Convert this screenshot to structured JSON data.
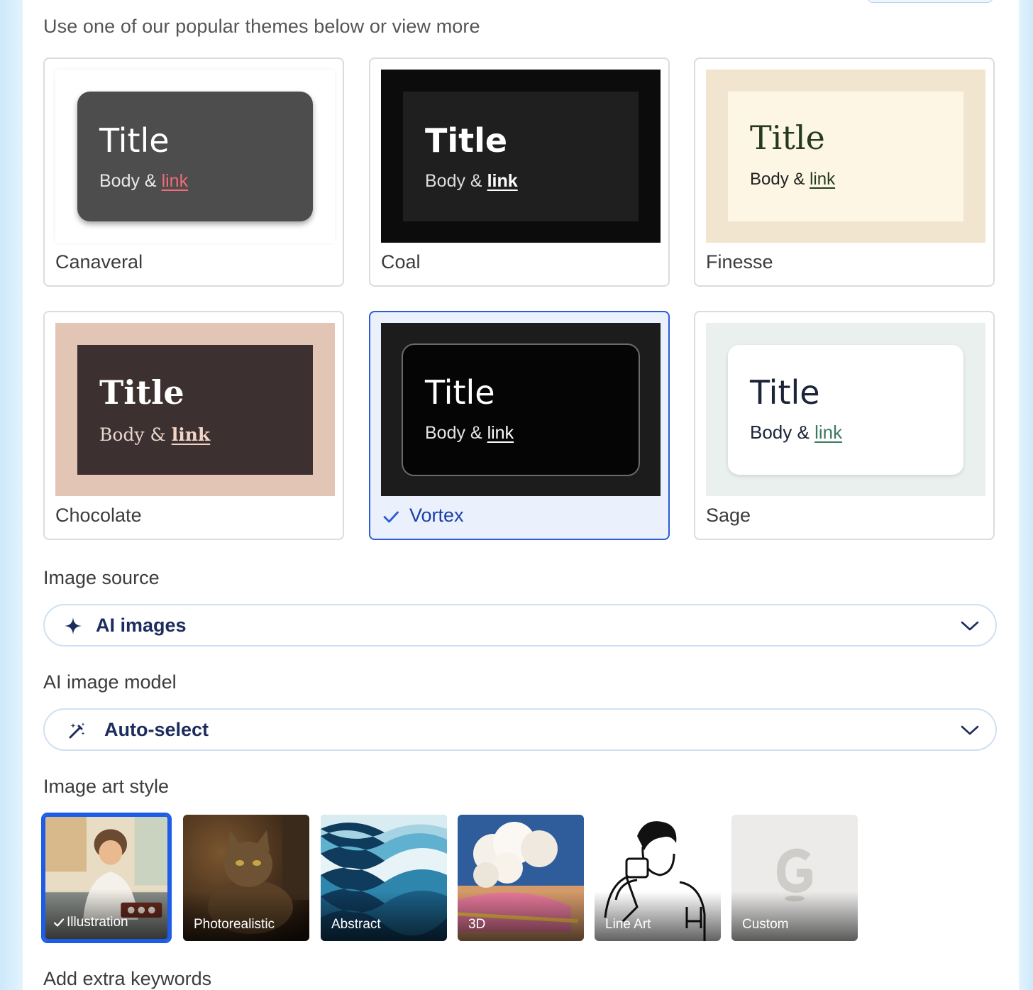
{
  "intro": "Use one of our popular themes below or view more",
  "themes": [
    {
      "name": "Canaveral",
      "title": "Title",
      "body": "Body &",
      "link": "link",
      "selected": false
    },
    {
      "name": "Coal",
      "title": "Title",
      "body": "Body &",
      "link": "link",
      "selected": false
    },
    {
      "name": "Finesse",
      "title": "Title",
      "body": "Body &",
      "link": "link",
      "selected": false
    },
    {
      "name": "Chocolate",
      "title": "Title",
      "body": "Body &",
      "link": "link",
      "selected": false
    },
    {
      "name": "Vortex",
      "title": "Title",
      "body": "Body &",
      "link": "link",
      "selected": true
    },
    {
      "name": "Sage",
      "title": "Title",
      "body": "Body &",
      "link": "link",
      "selected": false
    }
  ],
  "image_source": {
    "label": "Image source",
    "value": "AI images",
    "icon": "sparkle-icon"
  },
  "ai_model": {
    "label": "AI image model",
    "value": "Auto-select",
    "icon": "magic-wand-icon"
  },
  "art_style": {
    "label": "Image art style",
    "options": [
      {
        "name": "Illustration",
        "selected": true
      },
      {
        "name": "Photorealistic",
        "selected": false
      },
      {
        "name": "Abstract",
        "selected": false
      },
      {
        "name": "3D",
        "selected": false
      },
      {
        "name": "Line Art",
        "selected": false
      },
      {
        "name": "Custom",
        "selected": false
      }
    ]
  },
  "keywords_label": "Add extra keywords",
  "colors": {
    "accent": "#2f5bd3",
    "selected_bg": "#eaf1fd",
    "select_border": "#cfe0f3"
  }
}
